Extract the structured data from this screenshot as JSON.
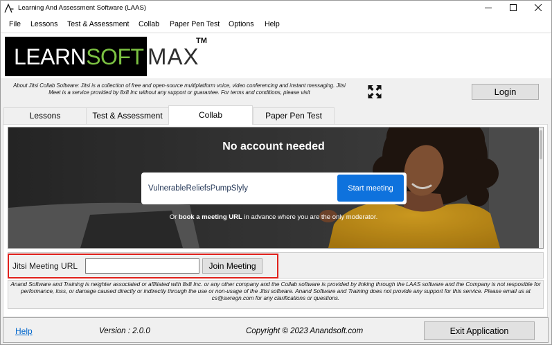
{
  "window": {
    "title": "Learning And Assessment Software (LAAS)",
    "icons": {
      "app": "laas-app-icon",
      "minimize": "minimize-icon",
      "maximize": "maximize-icon",
      "close": "close-icon"
    }
  },
  "menu": [
    "File",
    "Lessons",
    "Test & Assessment",
    "Collab",
    "Paper Pen Test",
    "Options",
    "Help"
  ],
  "logo": {
    "learn": "LEARN",
    "soft": "SOFT",
    "max": "MAX",
    "tm": "TM"
  },
  "about_text": "About Jitsi Collab Software: Jitsi is a collection of free and open-source multiplatform voice, video conferencing and instant messaging. Jitsi Meet is a service provided by 8x8 Inc without any support or guarantee. For terms and conditions, please visit",
  "fullscreen_icon": "fullscreen-expand-icon",
  "login": {
    "label": "Login"
  },
  "tabs": [
    {
      "label": "Lessons",
      "selected": false
    },
    {
      "label": "Test & Assessment",
      "selected": false
    },
    {
      "label": "Collab",
      "selected": true
    },
    {
      "label": "Paper Pen Test",
      "selected": false
    }
  ],
  "collab": {
    "web": {
      "headline": "No account needed",
      "meeting_name": "VulnerableReliefsPumpSlyly",
      "start_label": "Start meeting",
      "note": {
        "prefix": "Or ",
        "link": "book a meeting URL",
        "suffix": " in advance where you are the only moderator."
      }
    },
    "url_field": {
      "label": "Jitsi Meeting URL",
      "value": ""
    },
    "join_label": "Join Meeting",
    "disclaimer": "Anand Software and Training is neighter associated or affiliated with 8x8 Inc. or any other company and the Collab software is provided by linking through the LAAS software and the Company is not resposible for performance, loss, or damage caused directly or indirectly through the use or non-usage of the Jitsi software. Anand Software and Training does not provide any support for this service. Please email us at cs@swregn.com for any clarifications or questions."
  },
  "footer": {
    "help": "Help",
    "version": "Version : 2.0.0",
    "copyright": "Copyright © 2023 Anandsoft.com",
    "exit_label": "Exit Application"
  },
  "colors": {
    "logo_green": "#7cc242",
    "logo_white": "#ffffff",
    "start_button": "#0e72dd",
    "highlight_border": "#e0201b",
    "link_blue": "#0066cc",
    "meeting_text": "#253858"
  }
}
